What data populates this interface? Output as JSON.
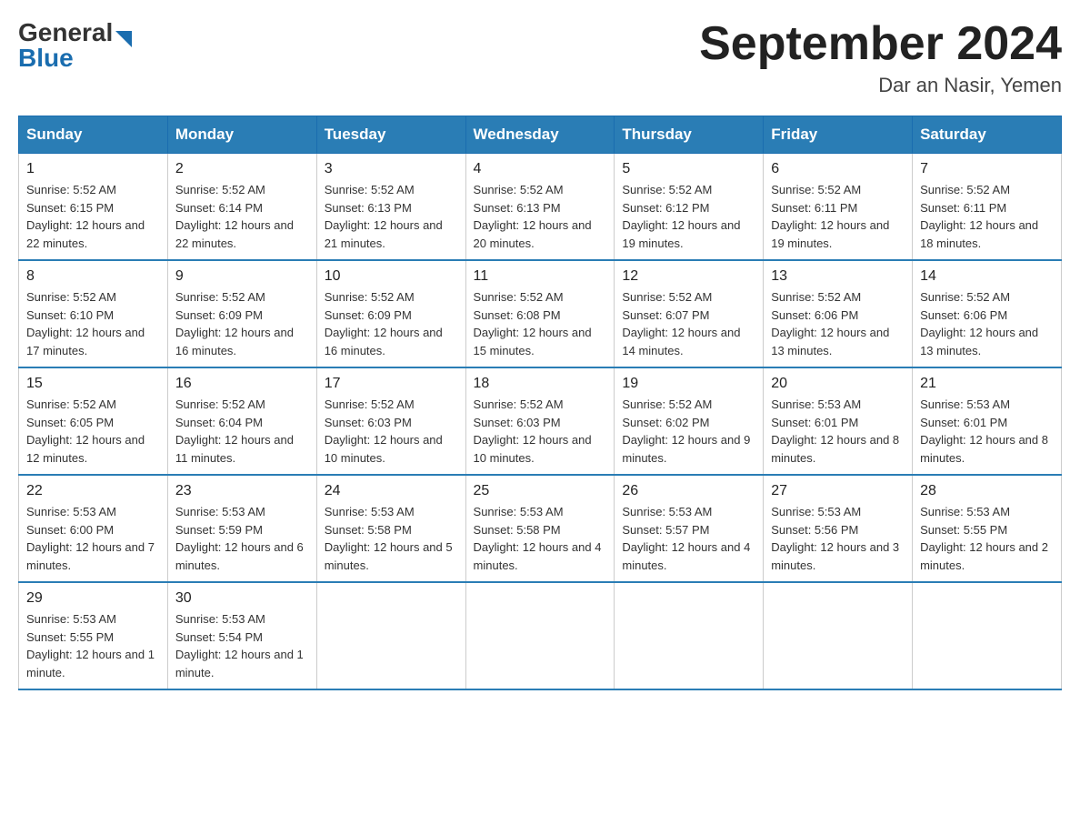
{
  "logo": {
    "general": "General",
    "arrow": "",
    "blue": "Blue"
  },
  "title": "September 2024",
  "location": "Dar an Nasir, Yemen",
  "headers": [
    "Sunday",
    "Monday",
    "Tuesday",
    "Wednesday",
    "Thursday",
    "Friday",
    "Saturday"
  ],
  "weeks": [
    [
      {
        "day": "1",
        "sunrise": "5:52 AM",
        "sunset": "6:15 PM",
        "daylight": "12 hours and 22 minutes."
      },
      {
        "day": "2",
        "sunrise": "5:52 AM",
        "sunset": "6:14 PM",
        "daylight": "12 hours and 22 minutes."
      },
      {
        "day": "3",
        "sunrise": "5:52 AM",
        "sunset": "6:13 PM",
        "daylight": "12 hours and 21 minutes."
      },
      {
        "day": "4",
        "sunrise": "5:52 AM",
        "sunset": "6:13 PM",
        "daylight": "12 hours and 20 minutes."
      },
      {
        "day": "5",
        "sunrise": "5:52 AM",
        "sunset": "6:12 PM",
        "daylight": "12 hours and 19 minutes."
      },
      {
        "day": "6",
        "sunrise": "5:52 AM",
        "sunset": "6:11 PM",
        "daylight": "12 hours and 19 minutes."
      },
      {
        "day": "7",
        "sunrise": "5:52 AM",
        "sunset": "6:11 PM",
        "daylight": "12 hours and 18 minutes."
      }
    ],
    [
      {
        "day": "8",
        "sunrise": "5:52 AM",
        "sunset": "6:10 PM",
        "daylight": "12 hours and 17 minutes."
      },
      {
        "day": "9",
        "sunrise": "5:52 AM",
        "sunset": "6:09 PM",
        "daylight": "12 hours and 16 minutes."
      },
      {
        "day": "10",
        "sunrise": "5:52 AM",
        "sunset": "6:09 PM",
        "daylight": "12 hours and 16 minutes."
      },
      {
        "day": "11",
        "sunrise": "5:52 AM",
        "sunset": "6:08 PM",
        "daylight": "12 hours and 15 minutes."
      },
      {
        "day": "12",
        "sunrise": "5:52 AM",
        "sunset": "6:07 PM",
        "daylight": "12 hours and 14 minutes."
      },
      {
        "day": "13",
        "sunrise": "5:52 AM",
        "sunset": "6:06 PM",
        "daylight": "12 hours and 13 minutes."
      },
      {
        "day": "14",
        "sunrise": "5:52 AM",
        "sunset": "6:06 PM",
        "daylight": "12 hours and 13 minutes."
      }
    ],
    [
      {
        "day": "15",
        "sunrise": "5:52 AM",
        "sunset": "6:05 PM",
        "daylight": "12 hours and 12 minutes."
      },
      {
        "day": "16",
        "sunrise": "5:52 AM",
        "sunset": "6:04 PM",
        "daylight": "12 hours and 11 minutes."
      },
      {
        "day": "17",
        "sunrise": "5:52 AM",
        "sunset": "6:03 PM",
        "daylight": "12 hours and 10 minutes."
      },
      {
        "day": "18",
        "sunrise": "5:52 AM",
        "sunset": "6:03 PM",
        "daylight": "12 hours and 10 minutes."
      },
      {
        "day": "19",
        "sunrise": "5:52 AM",
        "sunset": "6:02 PM",
        "daylight": "12 hours and 9 minutes."
      },
      {
        "day": "20",
        "sunrise": "5:53 AM",
        "sunset": "6:01 PM",
        "daylight": "12 hours and 8 minutes."
      },
      {
        "day": "21",
        "sunrise": "5:53 AM",
        "sunset": "6:01 PM",
        "daylight": "12 hours and 8 minutes."
      }
    ],
    [
      {
        "day": "22",
        "sunrise": "5:53 AM",
        "sunset": "6:00 PM",
        "daylight": "12 hours and 7 minutes."
      },
      {
        "day": "23",
        "sunrise": "5:53 AM",
        "sunset": "5:59 PM",
        "daylight": "12 hours and 6 minutes."
      },
      {
        "day": "24",
        "sunrise": "5:53 AM",
        "sunset": "5:58 PM",
        "daylight": "12 hours and 5 minutes."
      },
      {
        "day": "25",
        "sunrise": "5:53 AM",
        "sunset": "5:58 PM",
        "daylight": "12 hours and 4 minutes."
      },
      {
        "day": "26",
        "sunrise": "5:53 AM",
        "sunset": "5:57 PM",
        "daylight": "12 hours and 4 minutes."
      },
      {
        "day": "27",
        "sunrise": "5:53 AM",
        "sunset": "5:56 PM",
        "daylight": "12 hours and 3 minutes."
      },
      {
        "day": "28",
        "sunrise": "5:53 AM",
        "sunset": "5:55 PM",
        "daylight": "12 hours and 2 minutes."
      }
    ],
    [
      {
        "day": "29",
        "sunrise": "5:53 AM",
        "sunset": "5:55 PM",
        "daylight": "12 hours and 1 minute."
      },
      {
        "day": "30",
        "sunrise": "5:53 AM",
        "sunset": "5:54 PM",
        "daylight": "12 hours and 1 minute."
      },
      null,
      null,
      null,
      null,
      null
    ]
  ]
}
